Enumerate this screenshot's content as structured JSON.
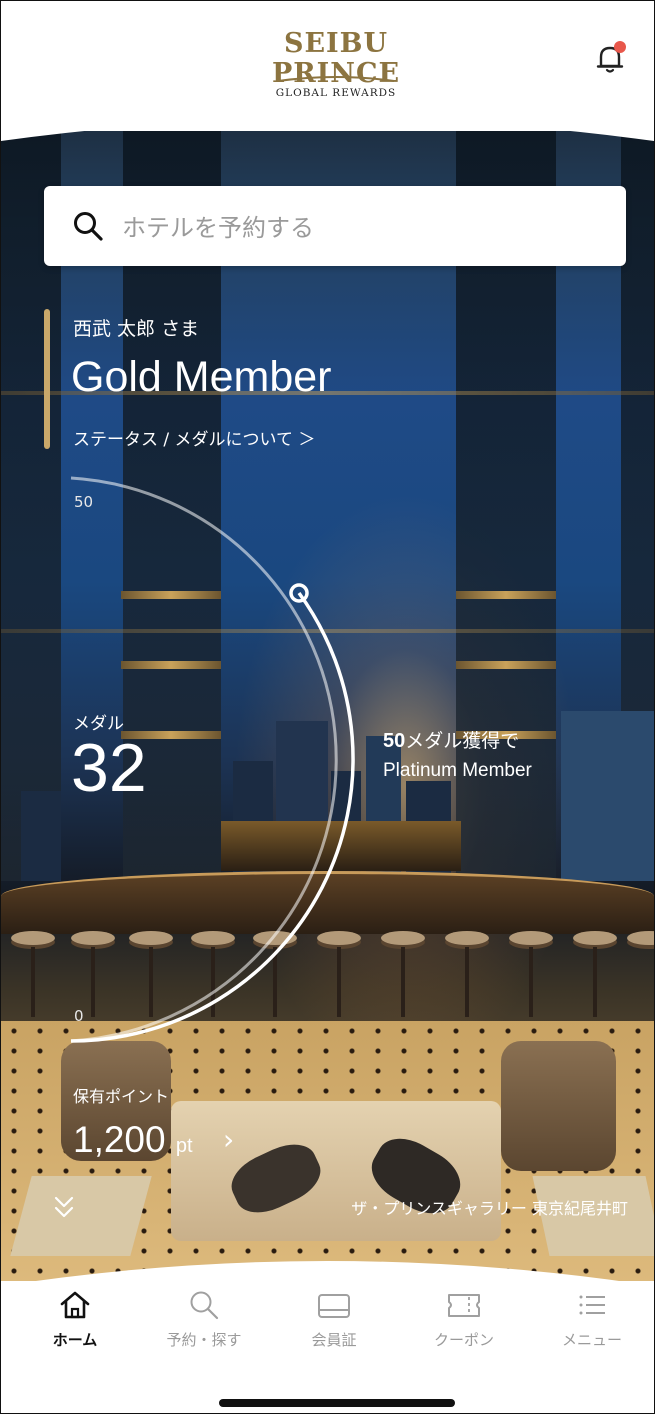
{
  "header": {
    "brand_main": "SEIBU PRINCE",
    "brand_sub": "GLOBAL REWARDS",
    "notification_badge_color": "#e8574b"
  },
  "search": {
    "placeholder": "ホテルを予約する"
  },
  "member": {
    "name": "西武 太郎 さま",
    "status": "Gold Member",
    "status_link": "ステータス / メダルについて ＞",
    "accent_color": "#c9a86a"
  },
  "medals": {
    "label": "メダル",
    "value": "32",
    "max_tick": "50",
    "min_tick": "0",
    "progress_fraction": 0.64,
    "next_goal_count": "50",
    "next_goal_text": "メダル獲得で",
    "next_goal_status": "Platinum Member"
  },
  "points": {
    "label": "保有ポイント",
    "value": "1,200",
    "unit": "pt",
    "arrow": "›"
  },
  "hero": {
    "location": "ザ・プリンスギャラリー 東京紀尾井町"
  },
  "nav": {
    "items": [
      {
        "label": "ホーム",
        "icon": "home-icon",
        "active": true
      },
      {
        "label": "予約・探す",
        "icon": "search-icon",
        "active": false
      },
      {
        "label": "会員証",
        "icon": "member-card-icon",
        "active": false
      },
      {
        "label": "クーポン",
        "icon": "coupon-icon",
        "active": false
      },
      {
        "label": "メニュー",
        "icon": "menu-icon",
        "active": false
      }
    ]
  }
}
